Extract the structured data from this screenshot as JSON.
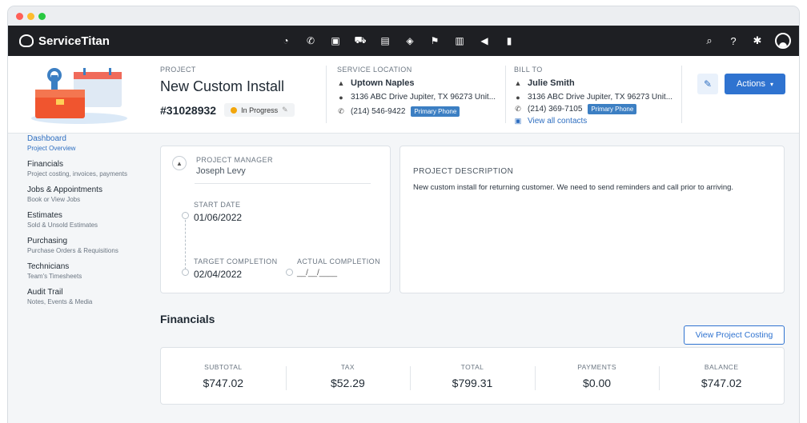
{
  "window": {
    "dots": [
      "#ff5f57",
      "#febc2e",
      "#28c840"
    ]
  },
  "topnav": {
    "brand": "ServiceTitan",
    "icons": [
      "dashboard-icon",
      "phone-icon",
      "calendar-icon",
      "truck-icon",
      "clipboard-icon",
      "box-icon",
      "flag-icon",
      "chart-icon",
      "megaphone-icon",
      "document-icon"
    ],
    "right_icons": [
      "search-icon",
      "help-icon",
      "settings-icon",
      "user-avatar-icon"
    ]
  },
  "header": {
    "project_label": "PROJECT",
    "project_title": "New Custom Install",
    "project_number": "#31028932",
    "status": "In Progress",
    "service_location": {
      "label": "SERVICE LOCATION",
      "name": "Uptown Naples",
      "address": "3136 ABC Drive Jupiter, TX 96273 Unit...",
      "phone": "(214) 546-9422",
      "phone_tag": "Primary Phone"
    },
    "bill_to": {
      "label": "BILL TO",
      "name": "Julie Smith",
      "address": "3136 ABC Drive Jupiter, TX 96273 Unit...",
      "phone": "(214) 369-7105",
      "phone_tag": "Primary Phone",
      "contacts_link": "View all contacts"
    },
    "actions_label": "Actions"
  },
  "sidebar": {
    "items": [
      {
        "title": "Dashboard",
        "sub": "Project Overview"
      },
      {
        "title": "Financials",
        "sub": "Project costing, invoices, payments"
      },
      {
        "title": "Jobs & Appointments",
        "sub": "Book or View Jobs"
      },
      {
        "title": "Estimates",
        "sub": "Sold & Unsold Estimates"
      },
      {
        "title": "Purchasing",
        "sub": "Purchase Orders & Requisitions"
      },
      {
        "title": "Technicians",
        "sub": "Team's Timesheets"
      },
      {
        "title": "Audit Trail",
        "sub": "Notes, Events & Media"
      }
    ]
  },
  "project_card": {
    "pm_label": "PROJECT MANAGER",
    "pm_name": "Joseph Levy",
    "start_label": "START DATE",
    "start_date": "01/06/2022",
    "target_label": "TARGET COMPLETION",
    "target_date": "02/04/2022",
    "actual_label": "ACTUAL COMPLETION",
    "actual_date": "__/__/____"
  },
  "description": {
    "label": "PROJECT DESCRIPTION",
    "text": "New custom install for returning customer. We need to send reminders and call prior to arriving."
  },
  "financials": {
    "title": "Financials",
    "costing_button": "View Project Costing",
    "items": [
      {
        "label": "SUBTOTAL",
        "value": "$747.02"
      },
      {
        "label": "TAX",
        "value": "$52.29"
      },
      {
        "label": "TOTAL",
        "value": "$799.31"
      },
      {
        "label": "PAYMENTS",
        "value": "$0.00"
      },
      {
        "label": "BALANCE",
        "value": "$747.02"
      }
    ]
  }
}
